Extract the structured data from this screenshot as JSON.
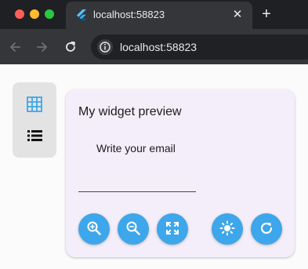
{
  "browser": {
    "tab_title": "localhost:58823",
    "url": "localhost:58823",
    "tab_favicon": "flutter-icon",
    "close_tab_glyph": "✕",
    "new_tab_glyph": "+"
  },
  "rail": {
    "items": [
      {
        "icon": "grid-icon",
        "selected": true
      },
      {
        "icon": "list-icon",
        "selected": false
      }
    ]
  },
  "card": {
    "title": "My widget preview",
    "field_label": "Write your email",
    "field_value": ""
  },
  "toolbar": {
    "buttons": [
      "zoom-in-icon",
      "zoom-out-icon",
      "fit-screen-icon",
      "brightness-icon",
      "refresh-icon"
    ]
  },
  "colors": {
    "accent": "#3ea6ea",
    "card_bg": "#f3eef9",
    "rail_bg": "#e3e3e3",
    "chrome_bg": "#1f2023",
    "toolbar_bg": "#35363a"
  }
}
